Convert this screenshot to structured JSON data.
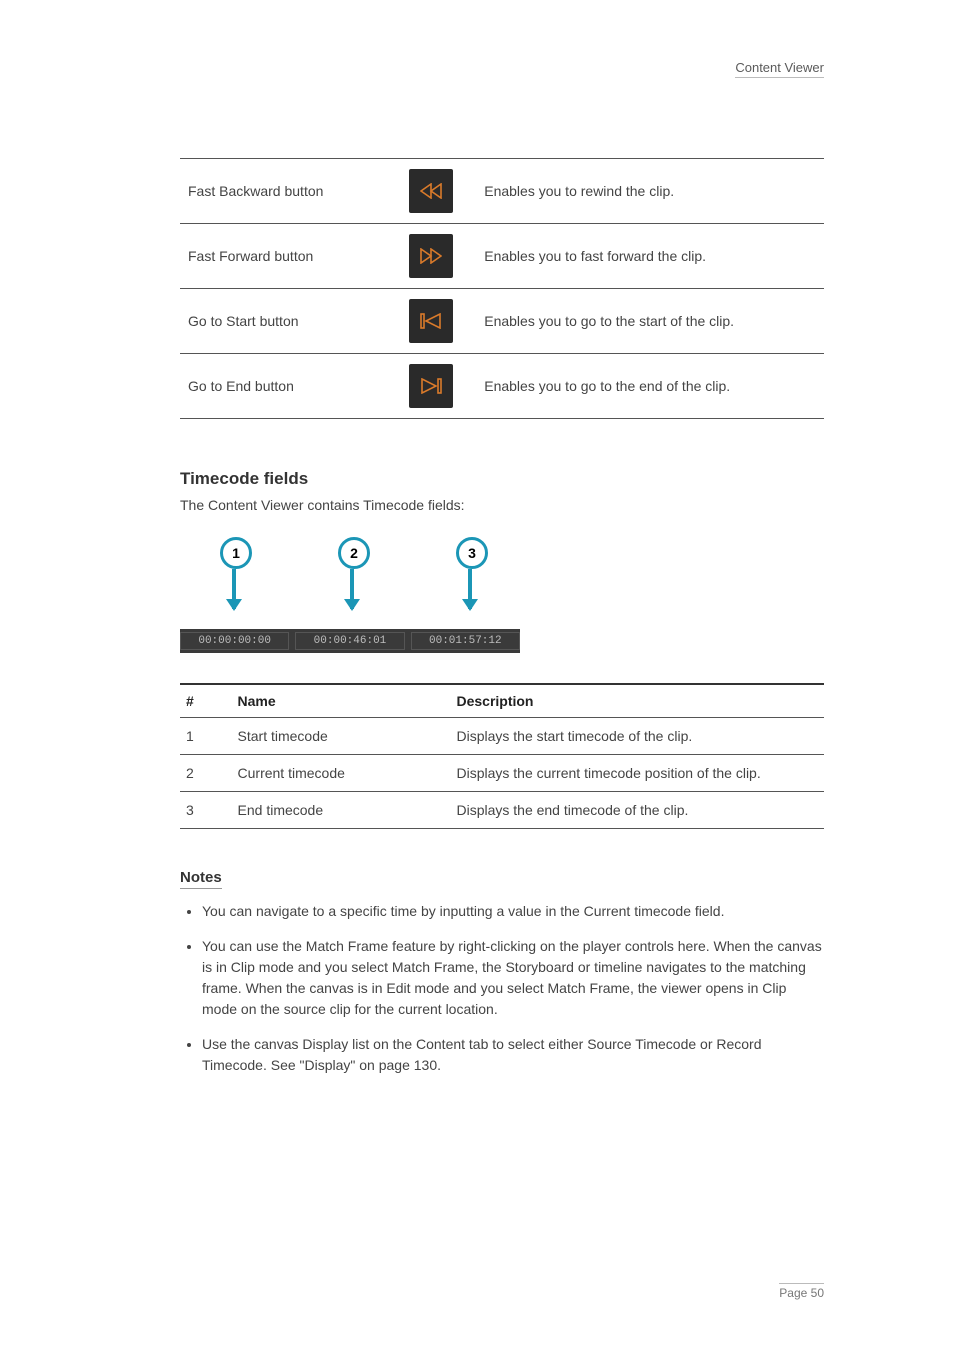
{
  "header": {
    "title": "Content Viewer"
  },
  "buttons_table": {
    "rows": [
      {
        "label": "Fast Backward button",
        "icon": "fast-backward",
        "desc": "Enables you to rewind the clip."
      },
      {
        "label": "Fast Forward button",
        "icon": "fast-forward",
        "desc": "Enables you to fast forward the clip."
      },
      {
        "label": "Go to Start button",
        "icon": "go-start",
        "desc": "Enables you to go to the start of the clip."
      },
      {
        "label": "Go to End button",
        "icon": "go-end",
        "desc": "Enables you to go to the end of the clip."
      }
    ]
  },
  "timecode_section": {
    "heading": "Timecode fields",
    "intro": "The Content Viewer contains Timecode fields:",
    "figure": {
      "callouts": [
        "1",
        "2",
        "3"
      ],
      "times": [
        "00:00:00:00",
        "00:00:46:01",
        "00:01:57:12"
      ]
    }
  },
  "desc_table": {
    "headers": [
      "#",
      "Name",
      "Description"
    ],
    "rows": [
      {
        "n": "1",
        "name": "Start timecode",
        "desc": "Displays the start timecode of the clip."
      },
      {
        "n": "2",
        "name": "Current timecode",
        "desc": "Displays the current timecode position of the clip."
      },
      {
        "n": "3",
        "name": "End timecode",
        "desc": "Displays the end timecode of the clip."
      }
    ]
  },
  "notes": {
    "heading": "Notes",
    "items": [
      "You can navigate to a specific time by inputting a value in the Current timecode field.",
      "You can use the Match Frame feature by right-clicking on the player controls here. When the canvas is in Clip mode and you select Match Frame, the Storyboard or timeline navigates to the matching frame. When the canvas is in Edit mode and you select Match Frame, the viewer opens in Clip mode on the source clip for the current location.",
      "Use the canvas Display list on the Content tab to select either Source Timecode or Record Timecode. See \"Display\" on page 130."
    ]
  },
  "footer": {
    "text": "Page 50"
  }
}
